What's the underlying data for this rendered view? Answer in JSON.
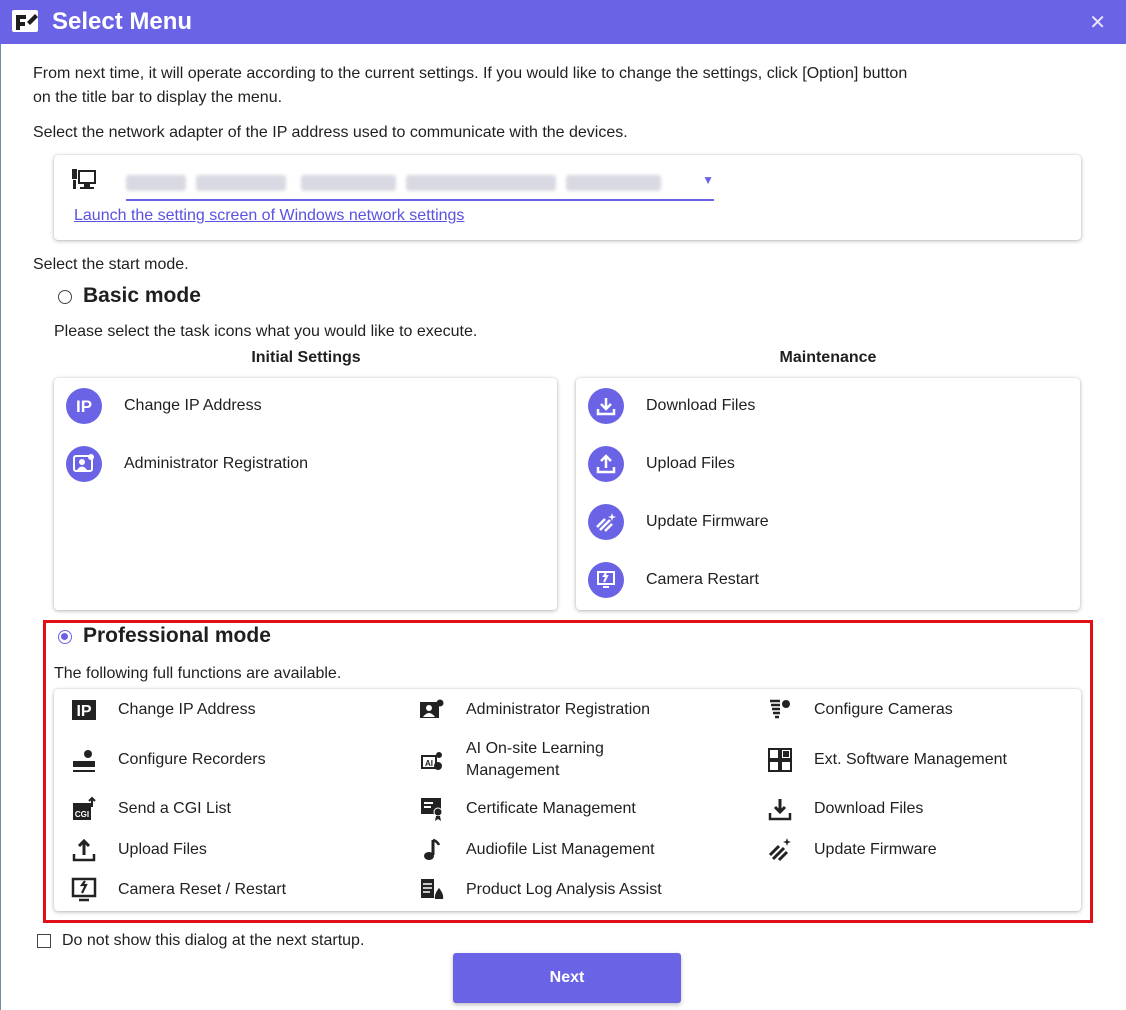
{
  "window": {
    "title": "Select Menu",
    "close_glyph": "✕"
  },
  "intro": {
    "line1": "From next time, it will operate according to the current settings. If you would like to change the settings, click [Option] button",
    "line2": "on the title bar to display the menu."
  },
  "network": {
    "prompt": "Select the network adapter of the IP address used to communicate with the devices.",
    "link": "Launch the setting screen of Windows network settings"
  },
  "start_mode_label": "Select the start mode.",
  "basic_mode": {
    "title": "Basic mode",
    "selected": false,
    "instruction": "Please select the task icons what you would like to execute.",
    "initial_settings": {
      "heading": "Initial Settings",
      "items": [
        {
          "label": "Change IP Address",
          "icon": "ip-icon"
        },
        {
          "label": "Administrator Registration",
          "icon": "admin-icon"
        }
      ]
    },
    "maintenance": {
      "heading": "Maintenance",
      "items": [
        {
          "label": "Download Files",
          "icon": "download-icon"
        },
        {
          "label": "Upload Files",
          "icon": "upload-icon"
        },
        {
          "label": "Update Firmware",
          "icon": "firmware-icon"
        },
        {
          "label": "Camera Restart",
          "icon": "restart-icon"
        }
      ]
    }
  },
  "professional_mode": {
    "title": "Professional mode",
    "selected": true,
    "description": "The following full functions are available.",
    "functions": [
      {
        "label": "Change IP Address",
        "icon": "ip-icon"
      },
      {
        "label": "Administrator Registration",
        "icon": "admin-icon"
      },
      {
        "label": "Configure Cameras",
        "icon": "camera-config-icon"
      },
      {
        "label": "Configure Recorders",
        "icon": "recorder-config-icon"
      },
      {
        "label": "AI On-site Learning Management",
        "icon": "ai-learning-icon"
      },
      {
        "label": "Ext. Software Management",
        "icon": "ext-software-icon"
      },
      {
        "label": "Send a CGI List",
        "icon": "cgi-icon"
      },
      {
        "label": "Certificate Management",
        "icon": "certificate-icon"
      },
      {
        "label": "Download Files",
        "icon": "download-icon"
      },
      {
        "label": "Upload Files",
        "icon": "upload-icon"
      },
      {
        "label": "Audiofile List Management",
        "icon": "audio-icon"
      },
      {
        "label": "Update Firmware",
        "icon": "firmware-icon"
      },
      {
        "label": "Camera Reset / Restart",
        "icon": "restart-icon"
      },
      {
        "label": "Product Log Analysis Assist",
        "icon": "log-analysis-icon"
      }
    ]
  },
  "footer": {
    "dont_show_label": "Do not show this dialog at the next startup.",
    "dont_show_checked": false,
    "next_label": "Next"
  },
  "colors": {
    "accent": "#6b63e5",
    "highlight_border": "#e0101b"
  }
}
